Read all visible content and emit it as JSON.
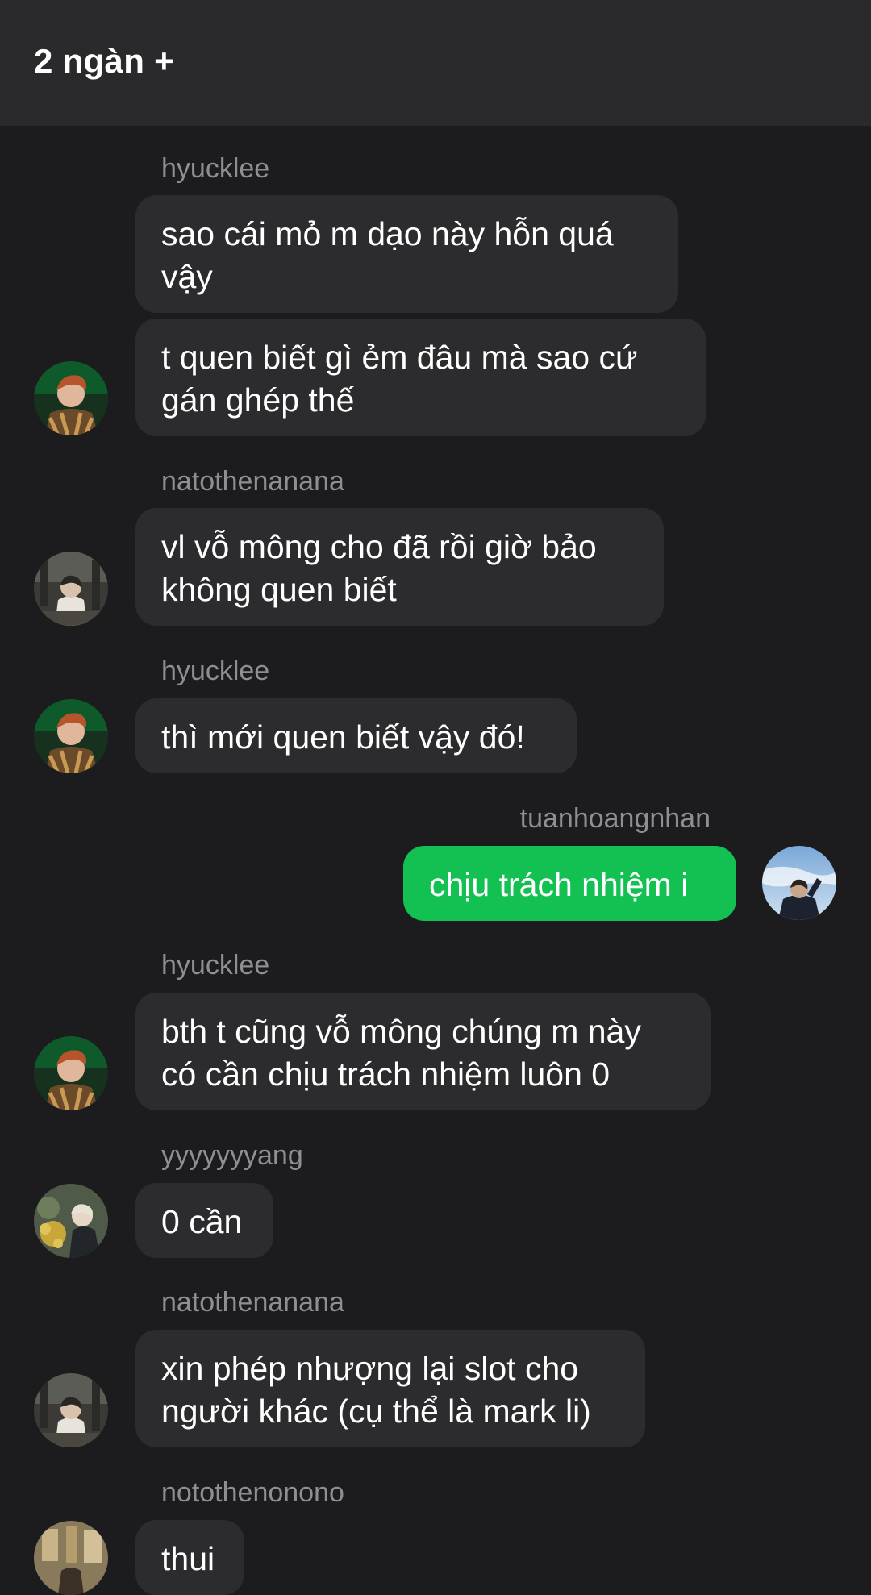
{
  "header": {
    "title": "2 ngàn +"
  },
  "messages": [
    {
      "sender": "hyucklee",
      "texts": [
        [
          "sao cái mỏ m dạo này hỗn quá",
          "vậy"
        ],
        [
          "t quen biết gì ẻm đâu mà sao cứ",
          "gán ghép thế"
        ]
      ]
    },
    {
      "sender": "natothenanana",
      "texts": [
        [
          "vl vỗ mông cho đã rồi giờ bảo",
          "không quen biết"
        ]
      ]
    },
    {
      "sender": "hyucklee",
      "texts": [
        [
          "thì mới quen biết vậy đó!"
        ]
      ]
    },
    {
      "sender": "tuanhoangnhan",
      "texts": [
        [
          "chịu trách nhiệm i"
        ]
      ]
    },
    {
      "sender": "hyucklee",
      "texts": [
        [
          "bth t cũng vỗ mông chúng m này",
          "có cần chịu trách nhiệm luôn 0"
        ]
      ]
    },
    {
      "sender": "yyyyyyyang",
      "texts": [
        [
          "0 cần"
        ]
      ]
    },
    {
      "sender": "natothenanana",
      "texts": [
        [
          "xin phép nhượng lại slot cho",
          "người khác (cụ thể là mark li)"
        ]
      ]
    },
    {
      "sender": "nototheno​nono",
      "texts": [
        [
          "thui"
        ]
      ]
    }
  ],
  "colors": {
    "background": "#1c1c1e",
    "header": "#2a2a2c",
    "bubble_incoming": "#2c2c2e",
    "bubble_outgoing": "#13c152",
    "sender_name": "#8e8e93"
  }
}
